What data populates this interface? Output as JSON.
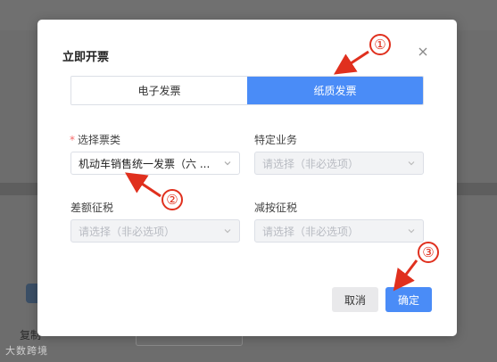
{
  "background": {
    "app_label": "复制",
    "card_label": "",
    "watermark": "大数跨境"
  },
  "dialog": {
    "title": "立即开票",
    "tabs": [
      {
        "label": "电子发票",
        "active": false
      },
      {
        "label": "纸质发票",
        "active": true
      }
    ],
    "fields": {
      "invoice_type": {
        "label": "选择票类",
        "required": true,
        "value": "机动车销售统一发票（六 ..."
      },
      "specific_business": {
        "label": "特定业务",
        "placeholder": "请选择（非必选项）"
      },
      "difference_tax": {
        "label": "差额征税",
        "placeholder": "请选择（非必选项）"
      },
      "reduced_tax": {
        "label": "减按征税",
        "placeholder": "请选择（非必选项）"
      }
    },
    "buttons": {
      "cancel": "取消",
      "confirm": "确定"
    }
  },
  "annotations": [
    "①",
    "②",
    "③"
  ],
  "colors": {
    "accent": "#4a8cf7",
    "annotation": "#e0301e",
    "required": "#f56c6c"
  }
}
